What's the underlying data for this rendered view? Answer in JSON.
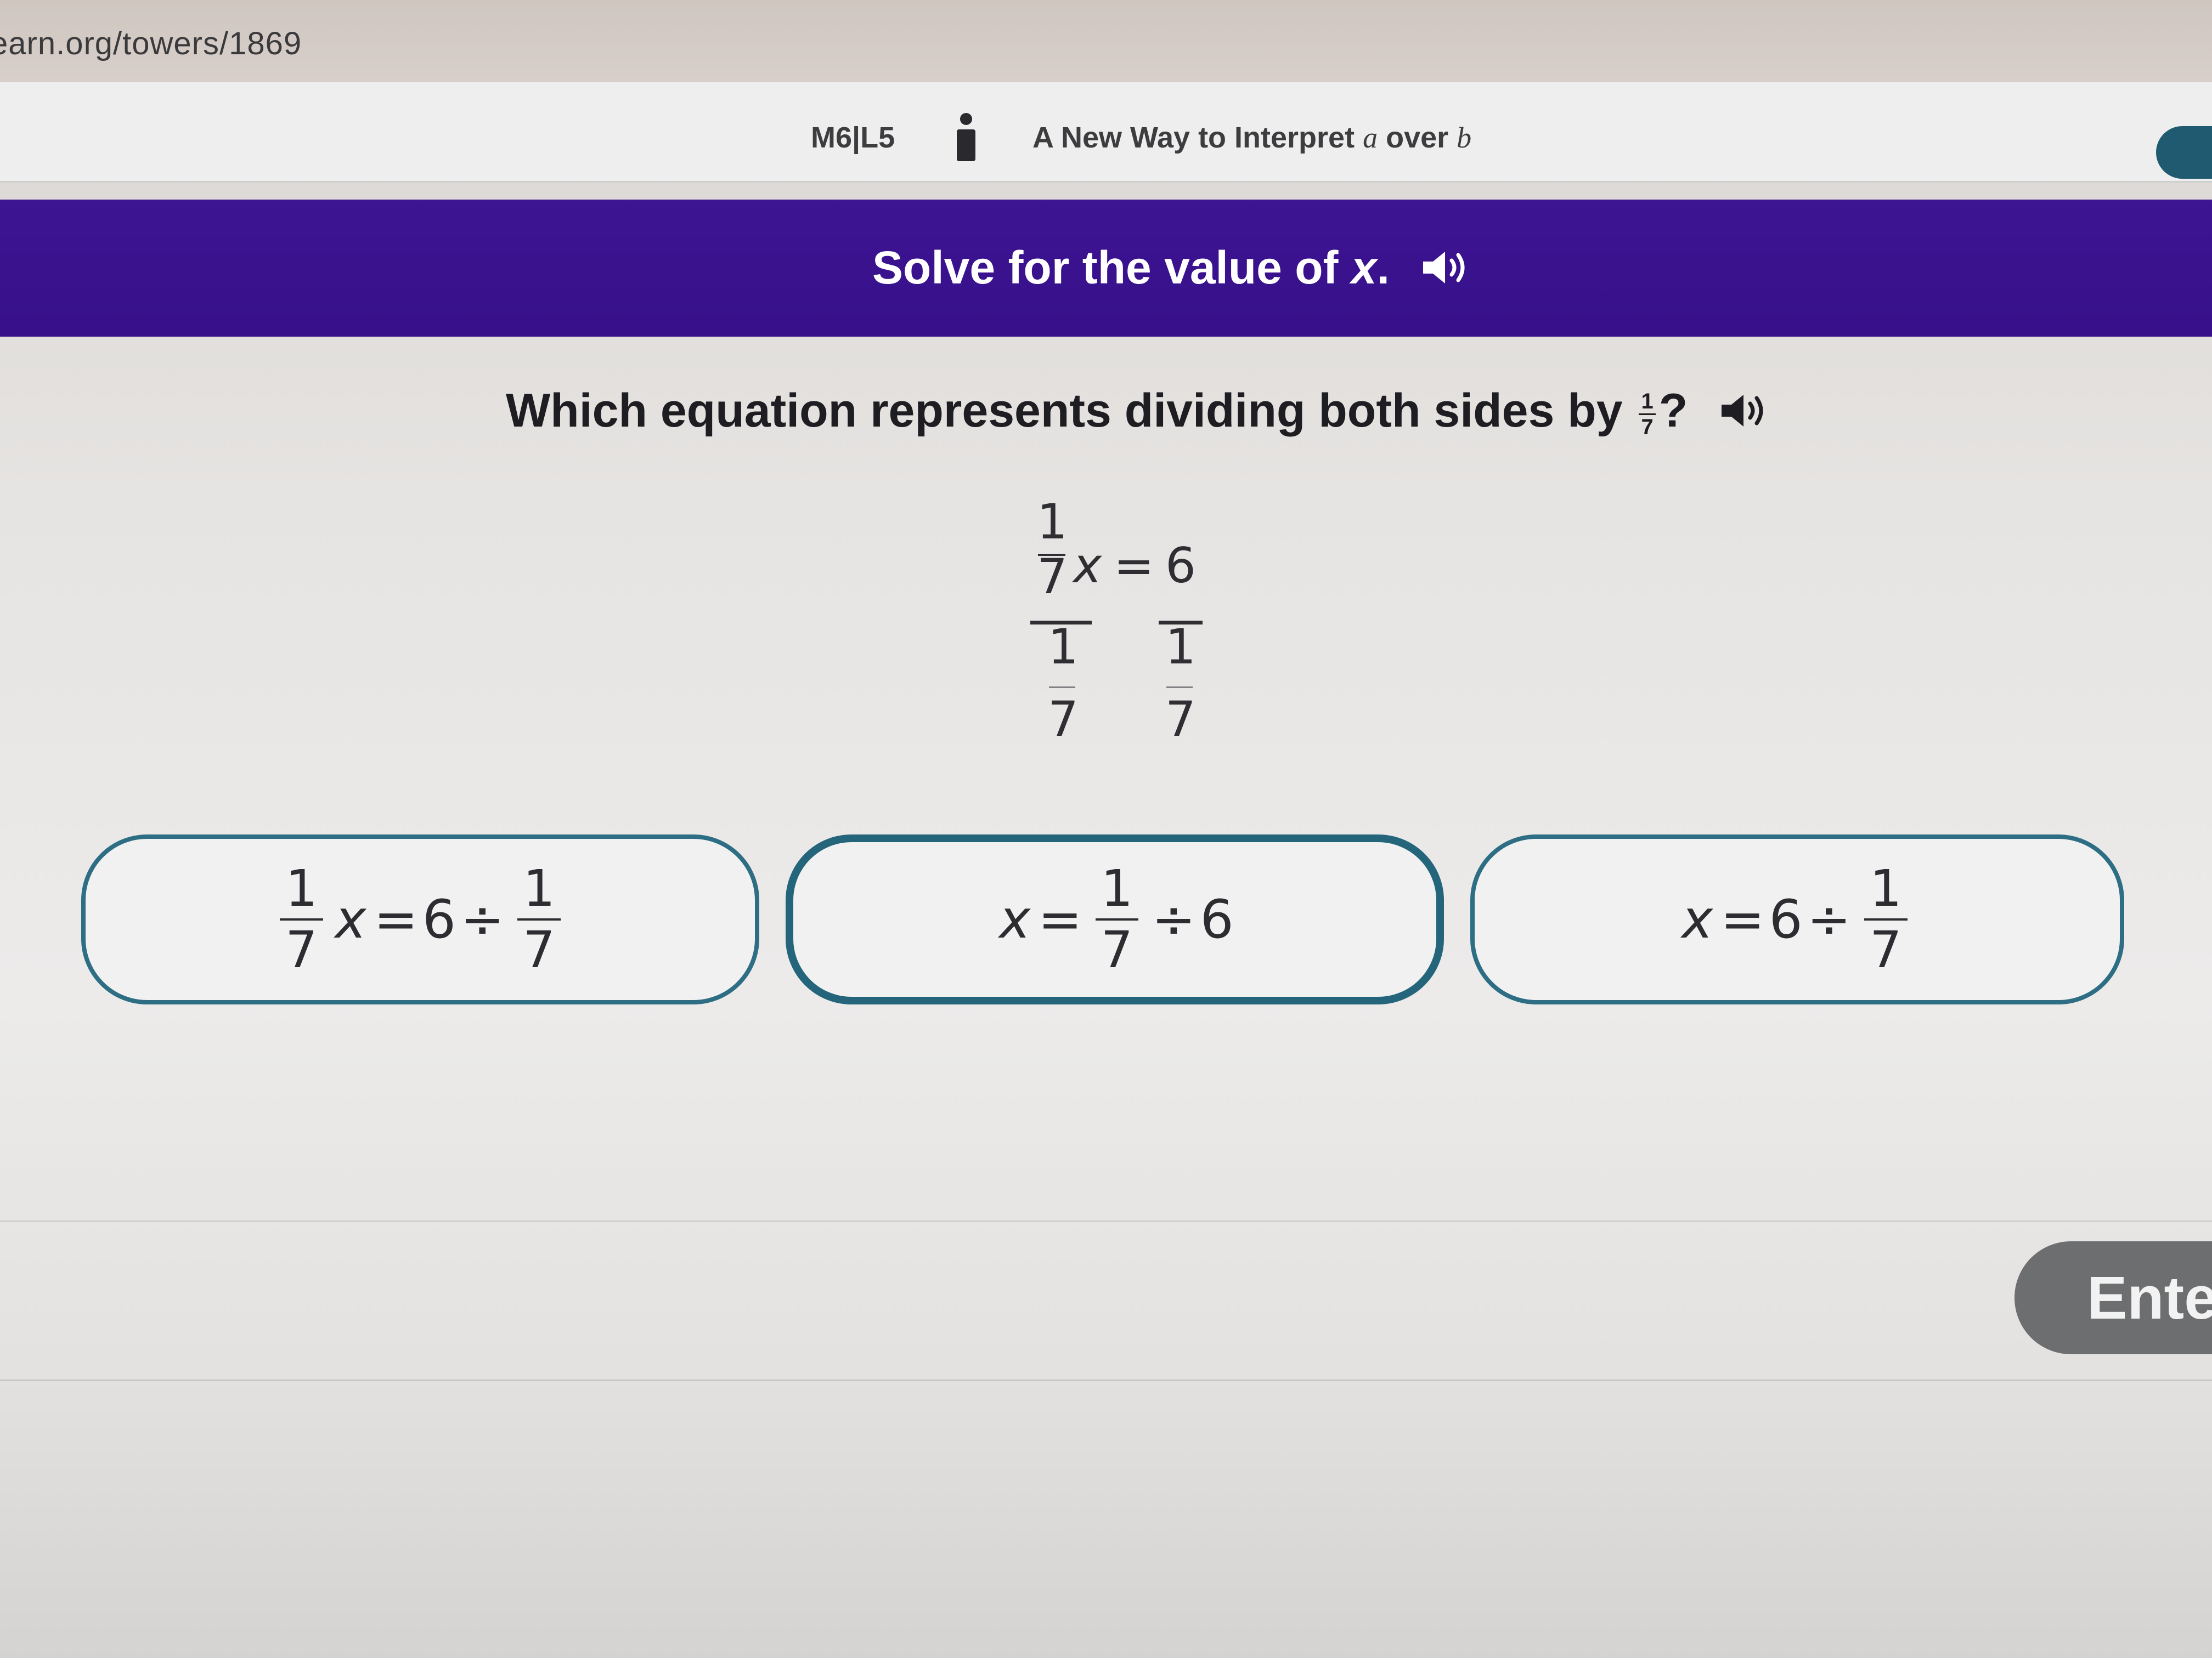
{
  "browser": {
    "url": "earn.org/towers/1869"
  },
  "lesson": {
    "code": "M6|L5",
    "title_prefix": "A New Way to Interpret ",
    "title_a": "a",
    "title_mid": " over ",
    "title_b": "b"
  },
  "instruction": {
    "text": "Solve for the value of ",
    "var": "x",
    "end": "."
  },
  "question": {
    "text": "Which equation represents dividing both sides by ",
    "frac_num": "1",
    "frac_den": "7",
    "end": "?"
  },
  "worked_equation": {
    "left_num": "1",
    "left_den": "7",
    "var": "x",
    "equals": "=",
    "right": "6",
    "divisor_left_num": "1",
    "divisor_left_den": "7",
    "divisor_right_num": "1",
    "divisor_right_den": "7"
  },
  "options": [
    {
      "coef_num": "1",
      "coef_den": "7",
      "var": "x",
      "equals": "=",
      "value": "6",
      "op": "÷",
      "div_num": "1",
      "div_den": "7"
    },
    {
      "var": "x",
      "equals": "=",
      "frac_num": "1",
      "frac_den": "7",
      "op": "÷",
      "value": "6",
      "selected": true
    },
    {
      "var": "x",
      "equals": "=",
      "value": "6",
      "op": "÷",
      "div_num": "1",
      "div_den": "7"
    }
  ],
  "footer": {
    "enter_label": "Ente"
  },
  "colors": {
    "purple_band": "#3d1492",
    "option_border": "#2d6e84",
    "enter_button": "#6c6e70"
  },
  "icons": [
    "info-icon",
    "speaker-icon"
  ]
}
